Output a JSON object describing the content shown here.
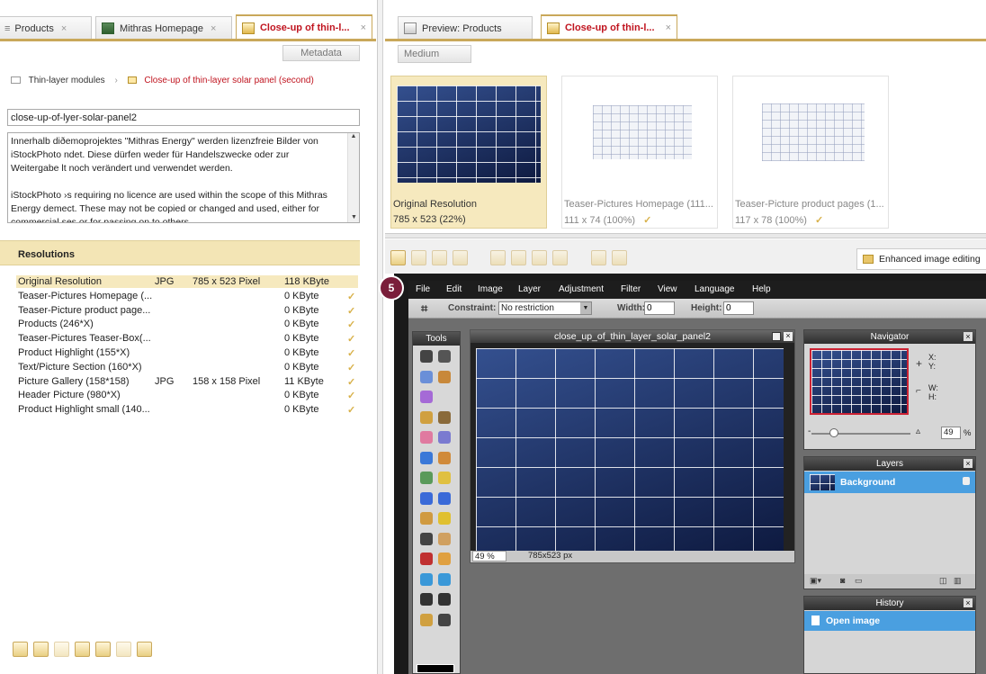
{
  "left_tabs": [
    {
      "label": "Products",
      "close": "×"
    },
    {
      "label": "Mithras Homepage",
      "close": "×"
    },
    {
      "label": "Close-up of thin-l...",
      "close": "×"
    }
  ],
  "right_tabs": [
    {
      "label": "Preview: Products"
    },
    {
      "label": "Close-up of thin-l...",
      "close": "×"
    }
  ],
  "metadata_button": "Metadata",
  "medium_button": "Medium",
  "breadcrumb": {
    "parent": "Thin-layer modules",
    "current": "Close-up of thin-layer solar panel (second)"
  },
  "name_field": "close-up-of-lyer-solar-panel2",
  "description_lines": [
    "Innerhalb diðemoprojektes \"Mithras Energy\" werden lizenzfreie Bilder von",
    "iStockPhoto ndet. Diese dürfen weder für Handelszwecke oder zur",
    "Weitergabe lt noch verändert und verwendet werden.",
    "",
    "iStockPhoto ›s requiring no licence are used within the scope of this Mithras",
    "Energy demect. These may not be copied or changed and used, either for",
    "commercial ses or for passing on to others."
  ],
  "resolutions_header": "Resolutions",
  "resolutions": [
    {
      "name": "Original Resolution",
      "format": "JPG",
      "dims": "785 x 523 Pixel",
      "size": "118 KByte",
      "check": ""
    },
    {
      "name": "Teaser-Pictures Homepage (...",
      "format": "",
      "dims": "",
      "size": "0 KByte",
      "check": "✓"
    },
    {
      "name": "Teaser-Picture product page...",
      "format": "",
      "dims": "",
      "size": "0 KByte",
      "check": "✓"
    },
    {
      "name": "Products (246*X)",
      "format": "",
      "dims": "",
      "size": "0 KByte",
      "check": "✓"
    },
    {
      "name": "Teaser-Pictures Teaser-Box(...",
      "format": "",
      "dims": "",
      "size": "0 KByte",
      "check": "✓"
    },
    {
      "name": "Product Highlight (155*X)",
      "format": "",
      "dims": "",
      "size": "0 KByte",
      "check": "✓"
    },
    {
      "name": "Text/Picture Section (160*X)",
      "format": "",
      "dims": "",
      "size": "0 KByte",
      "check": "✓"
    },
    {
      "name": "Picture Gallery (158*158)",
      "format": "JPG",
      "dims": "158 x 158 Pixel",
      "size": "11 KByte",
      "check": "✓"
    },
    {
      "name": "Header Picture (980*X)",
      "format": "",
      "dims": "",
      "size": "0 KByte",
      "check": "✓"
    },
    {
      "name": "Product Highlight small (140...",
      "format": "",
      "dims": "",
      "size": "0 KByte",
      "check": "✓"
    }
  ],
  "thumbnails": [
    {
      "label": "Original Resolution",
      "info": "785 x 523 (22%)",
      "check": ""
    },
    {
      "label": "Teaser-Pictures Homepage (111...",
      "info": "111 x 74 (100%)",
      "check": "✓"
    },
    {
      "label": "Teaser-Picture product pages (1...",
      "info": "117 x 78 (100%)",
      "check": "✓"
    }
  ],
  "enhanced_button": "Enhanced image editing",
  "step_badge": "5",
  "editor": {
    "menu": [
      "File",
      "Edit",
      "Image",
      "Layer",
      "Adjustment",
      "Filter",
      "View",
      "Language",
      "Help"
    ],
    "constraint_label": "Constraint:",
    "constraint_value": "No restriction",
    "width_label": "Width:",
    "width_value": "0",
    "height_label": "Height:",
    "height_value": "0",
    "tools_title": "Tools",
    "doc_title": "close_up_of_thin_layer_solar_panel2",
    "zoom": "49",
    "zoom_unit": "%",
    "doc_size": "785x523 px",
    "navigator_title": "Navigator",
    "nav_x": "X:",
    "nav_y": "Y:",
    "nav_w": "W:",
    "nav_h": "H:",
    "nav_zoom": "49",
    "nav_zoom_unit": "%",
    "layers_title": "Layers",
    "layer_name": "Background",
    "history_title": "History",
    "history_item": "Open image"
  },
  "colors": {
    "accent": "#c9a85a",
    "highlight": "#f6e9be",
    "tab_red": "#c0141f",
    "editor_select": "#4a9fe0"
  }
}
